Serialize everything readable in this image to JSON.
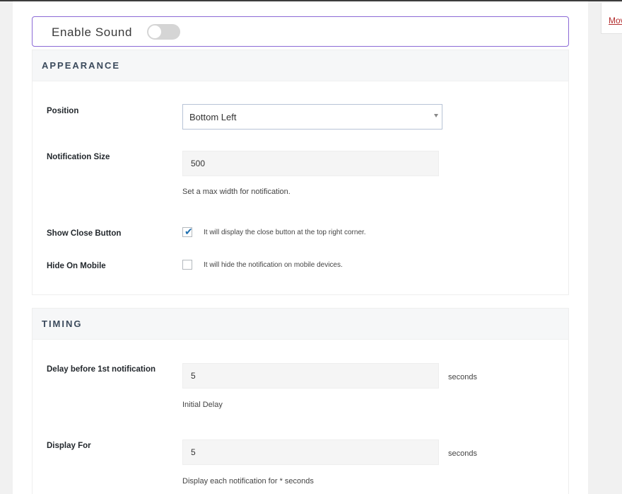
{
  "side": {
    "link": "Mov"
  },
  "sound": {
    "label": "Enable Sound",
    "enabled": false
  },
  "appearance": {
    "title": "APPEARANCE",
    "position_label": "Position",
    "position_value": "Bottom Left",
    "size_label": "Notification Size",
    "size_value": "500",
    "size_help": "Set a max width for notification.",
    "close_label": "Show Close Button",
    "close_checked": true,
    "close_help": "It will display the close button at the top right corner.",
    "mobile_label": "Hide On Mobile",
    "mobile_checked": false,
    "mobile_help": "It will hide the notification on mobile devices."
  },
  "timing": {
    "title": "TIMING",
    "delay_label": "Delay before 1st notification",
    "delay_value": "5",
    "delay_unit": "seconds",
    "delay_help": "Initial Delay",
    "display_label": "Display For",
    "display_value": "5",
    "display_unit": "seconds",
    "display_help": "Display each notification for * seconds"
  },
  "colors": {
    "accent_border": "#8c6ad6",
    "check": "#2271b1",
    "link": "#b32d2e"
  }
}
